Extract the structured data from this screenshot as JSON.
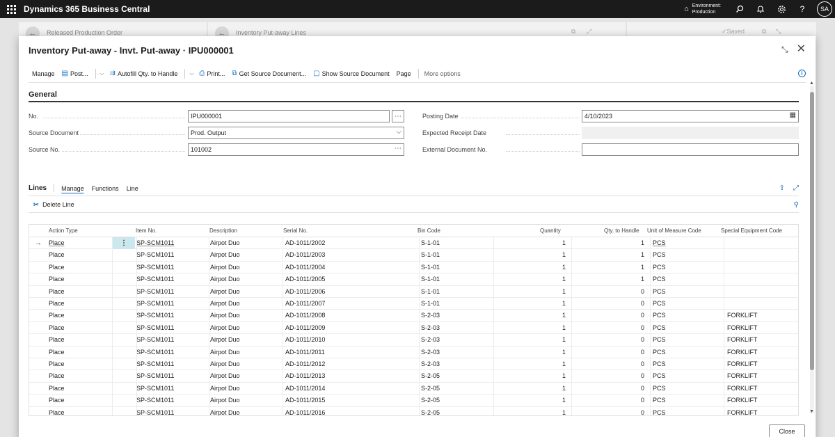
{
  "appbar": {
    "title": "Dynamics 365 Business Central",
    "env_label": "Environment:",
    "env_name": "Production",
    "avatar": "SA",
    "help": "?"
  },
  "background": {
    "page1_title": "Released Production Order",
    "page2_title": "Inventory Put-away Lines",
    "saved": "✓Saved"
  },
  "dialog": {
    "title": "Inventory Put-away - Invt. Put-away · IPU000001",
    "actions": {
      "manage": "Manage",
      "post": "Post...",
      "autofill": "Autofill Qty. to Handle",
      "print": "Print...",
      "get_source": "Get Source Document...",
      "show_source": "Show Source Document",
      "page": "Page",
      "more": "More options"
    },
    "general": {
      "heading": "General",
      "no_label": "No.",
      "no_value": "IPU000001",
      "source_doc_label": "Source Document",
      "source_doc_value": "Prod. Output",
      "source_no_label": "Source No.",
      "source_no_value": "101002",
      "posting_date_label": "Posting Date",
      "posting_date_value": "4/10/2023",
      "expected_label": "Expected Receipt Date",
      "expected_value": "",
      "external_label": "External Document No.",
      "external_value": ""
    },
    "lines": {
      "title": "Lines",
      "tabs": [
        "Manage",
        "Functions",
        "Line"
      ],
      "delete_line": "Delete Line",
      "columns": [
        "Action Type",
        "Item No.",
        "Description",
        "Serial No.",
        "Bin Code",
        "Quantity",
        "Qty. to Handle",
        "Unit of Measure Code",
        "Special Equipment Code"
      ],
      "rows": [
        {
          "action": "Place",
          "item": "SP-SCM1011",
          "desc": "Airpot Duo",
          "serial": "AD-1011/2002",
          "bin": "S-1-01",
          "qty": "1",
          "handle": "1",
          "uom": "PCS",
          "equip": ""
        },
        {
          "action": "Place",
          "item": "SP-SCM1011",
          "desc": "Airpot Duo",
          "serial": "AD-1011/2003",
          "bin": "S-1-01",
          "qty": "1",
          "handle": "1",
          "uom": "PCS",
          "equip": ""
        },
        {
          "action": "Place",
          "item": "SP-SCM1011",
          "desc": "Airpot Duo",
          "serial": "AD-1011/2004",
          "bin": "S-1-01",
          "qty": "1",
          "handle": "1",
          "uom": "PCS",
          "equip": ""
        },
        {
          "action": "Place",
          "item": "SP-SCM1011",
          "desc": "Airpot Duo",
          "serial": "AD-1011/2005",
          "bin": "S-1-01",
          "qty": "1",
          "handle": "1",
          "uom": "PCS",
          "equip": ""
        },
        {
          "action": "Place",
          "item": "SP-SCM1011",
          "desc": "Airpot Duo",
          "serial": "AD-1011/2006",
          "bin": "S-1-01",
          "qty": "1",
          "handle": "0",
          "uom": "PCS",
          "equip": ""
        },
        {
          "action": "Place",
          "item": "SP-SCM1011",
          "desc": "Airpot Duo",
          "serial": "AD-1011/2007",
          "bin": "S-1-01",
          "qty": "1",
          "handle": "0",
          "uom": "PCS",
          "equip": ""
        },
        {
          "action": "Place",
          "item": "SP-SCM1011",
          "desc": "Airpot Duo",
          "serial": "AD-1011/2008",
          "bin": "S-2-03",
          "qty": "1",
          "handle": "0",
          "uom": "PCS",
          "equip": "FORKLIFT"
        },
        {
          "action": "Place",
          "item": "SP-SCM1011",
          "desc": "Airpot Duo",
          "serial": "AD-1011/2009",
          "bin": "S-2-03",
          "qty": "1",
          "handle": "0",
          "uom": "PCS",
          "equip": "FORKLIFT"
        },
        {
          "action": "Place",
          "item": "SP-SCM1011",
          "desc": "Airpot Duo",
          "serial": "AD-1011/2010",
          "bin": "S-2-03",
          "qty": "1",
          "handle": "0",
          "uom": "PCS",
          "equip": "FORKLIFT"
        },
        {
          "action": "Place",
          "item": "SP-SCM1011",
          "desc": "Airpot Duo",
          "serial": "AD-1011/2011",
          "bin": "S-2-03",
          "qty": "1",
          "handle": "0",
          "uom": "PCS",
          "equip": "FORKLIFT"
        },
        {
          "action": "Place",
          "item": "SP-SCM1011",
          "desc": "Airpot Duo",
          "serial": "AD-1011/2012",
          "bin": "S-2-03",
          "qty": "1",
          "handle": "0",
          "uom": "PCS",
          "equip": "FORKLIFT"
        },
        {
          "action": "Place",
          "item": "SP-SCM1011",
          "desc": "Airpot Duo",
          "serial": "AD-1011/2013",
          "bin": "S-2-05",
          "qty": "1",
          "handle": "0",
          "uom": "PCS",
          "equip": "FORKLIFT"
        },
        {
          "action": "Place",
          "item": "SP-SCM1011",
          "desc": "Airpot Duo",
          "serial": "AD-1011/2014",
          "bin": "S-2-05",
          "qty": "1",
          "handle": "0",
          "uom": "PCS",
          "equip": "FORKLIFT"
        },
        {
          "action": "Place",
          "item": "SP-SCM1011",
          "desc": "Airpot Duo",
          "serial": "AD-1011/2015",
          "bin": "S-2-05",
          "qty": "1",
          "handle": "0",
          "uom": "PCS",
          "equip": "FORKLIFT"
        },
        {
          "action": "Place",
          "item": "SP-SCM1011",
          "desc": "Airpot Duo",
          "serial": "AD-1011/2016",
          "bin": "S-2-05",
          "qty": "1",
          "handle": "0",
          "uom": "PCS",
          "equip": "FORKLIFT"
        }
      ]
    },
    "close_label": "Close"
  },
  "colors": {
    "accent": "#0f6cbd",
    "appbar": "#1b1b1b",
    "selected_cell": "#cce8ef"
  }
}
